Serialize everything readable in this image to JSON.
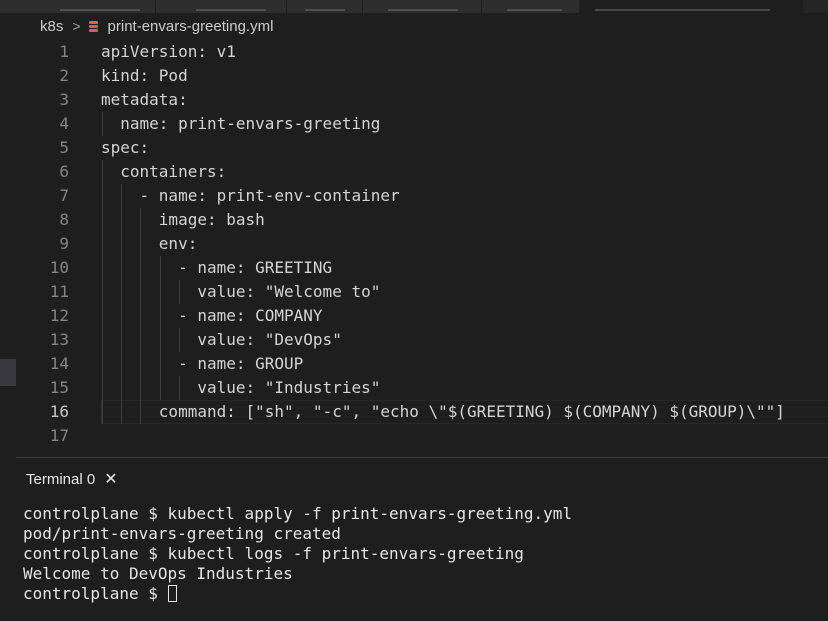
{
  "breadcrumb": {
    "folder": "k8s",
    "separator": ">",
    "file": "print-envars-greeting.yml",
    "file_icon": "yaml-file-icon"
  },
  "editor": {
    "current_line": 16,
    "lines": [
      {
        "num": "1",
        "text": "apiVersion: v1"
      },
      {
        "num": "2",
        "text": "kind: Pod"
      },
      {
        "num": "3",
        "text": "metadata:"
      },
      {
        "num": "4",
        "text": "  name: print-envars-greeting"
      },
      {
        "num": "5",
        "text": "spec:"
      },
      {
        "num": "6",
        "text": "  containers:"
      },
      {
        "num": "7",
        "text": "    - name: print-env-container"
      },
      {
        "num": "8",
        "text": "      image: bash"
      },
      {
        "num": "9",
        "text": "      env:"
      },
      {
        "num": "10",
        "text": "        - name: GREETING"
      },
      {
        "num": "11",
        "text": "          value: \"Welcome to\""
      },
      {
        "num": "12",
        "text": "        - name: COMPANY"
      },
      {
        "num": "13",
        "text": "          value: \"DevOps\""
      },
      {
        "num": "14",
        "text": "        - name: GROUP"
      },
      {
        "num": "15",
        "text": "          value: \"Industries\""
      },
      {
        "num": "16",
        "text": "      command: [\"sh\", \"-c\", \"echo \\\"$(GREETING) $(COMPANY) $(GROUP)\\\"\"]"
      },
      {
        "num": "17",
        "text": ""
      }
    ]
  },
  "terminal": {
    "tab_label": "Terminal 0",
    "close_icon": "close-icon",
    "lines": [
      "controlplane $ kubectl apply -f print-envars-greeting.yml",
      "pod/print-envars-greeting created",
      "controlplane $ kubectl logs -f print-envars-greeting",
      "Welcome to DevOps Industries"
    ],
    "prompt": "controlplane $ "
  },
  "colors": {
    "background": "#1e1e1e",
    "text": "#d4d4d4",
    "line_number": "#858585",
    "yaml_icon": "#e05a5a"
  }
}
